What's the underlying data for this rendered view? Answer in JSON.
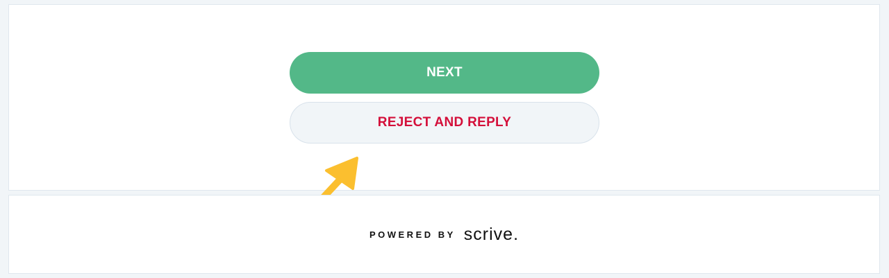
{
  "actions": {
    "next_label": "NEXT",
    "reject_label": "REJECT AND REPLY"
  },
  "footer": {
    "powered_by": "POWERED BY",
    "brand": "scrive."
  },
  "colors": {
    "next_bg": "#53b888",
    "reject_text": "#d40f3a",
    "arrow": "#fbbf2f"
  },
  "icons": [
    "pointer-arrow-icon"
  ]
}
